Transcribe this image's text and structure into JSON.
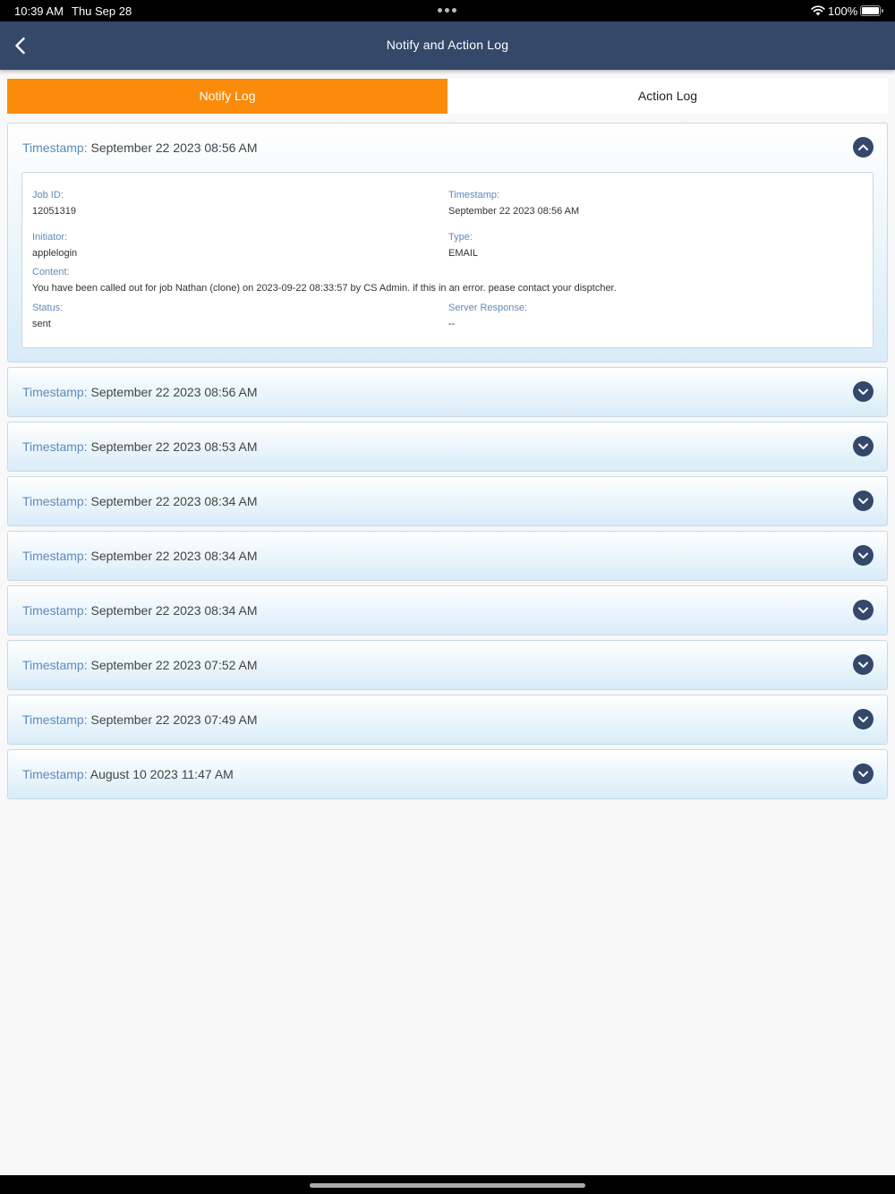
{
  "status_bar": {
    "time": "10:39 AM",
    "date": "Thu Sep 28",
    "battery": "100%"
  },
  "nav": {
    "title": "Notify and Action Log",
    "back_icon": "chevron-left-icon"
  },
  "tabs": [
    {
      "label": "Notify Log",
      "active": true,
      "color": "#fb8b0a"
    },
    {
      "label": "Action Log",
      "active": false
    }
  ],
  "log_label": "Timestamp:",
  "expanded": {
    "timestamp": "September 22 2023 08:56 AM",
    "job_id_label": "Job ID:",
    "job_id": "12051319",
    "timestamp_label": "Timestamp:",
    "timestamp_value": "September 22 2023 08:56 AM",
    "initiator_label": "Initiator:",
    "initiator": "applelogin",
    "type_label": "Type:",
    "type": "EMAIL",
    "content_label": "Content:",
    "content": "You have been called out for job Nathan (clone) on 2023-09-22 08:33:57 by CS Admin. if this in an error. pease contact your disptcher.",
    "status_label": "Status:",
    "status": "sent",
    "server_response_label": "Server Response:",
    "server_response": "--"
  },
  "collapsed_items": [
    {
      "timestamp": "September 22 2023 08:56 AM"
    },
    {
      "timestamp": "September 22 2023 08:53 AM"
    },
    {
      "timestamp": "September 22 2023 08:34 AM"
    },
    {
      "timestamp": "September 22 2023 08:34 AM"
    },
    {
      "timestamp": "September 22 2023 08:34 AM"
    },
    {
      "timestamp": "September 22 2023 07:52 AM"
    },
    {
      "timestamp": "September 22 2023 07:49 AM"
    },
    {
      "timestamp": "August 10 2023 11:47 AM"
    }
  ],
  "colors": {
    "nav": "#34486a",
    "accent": "#fb8b0a",
    "label_blue": "#5f8ab8"
  }
}
